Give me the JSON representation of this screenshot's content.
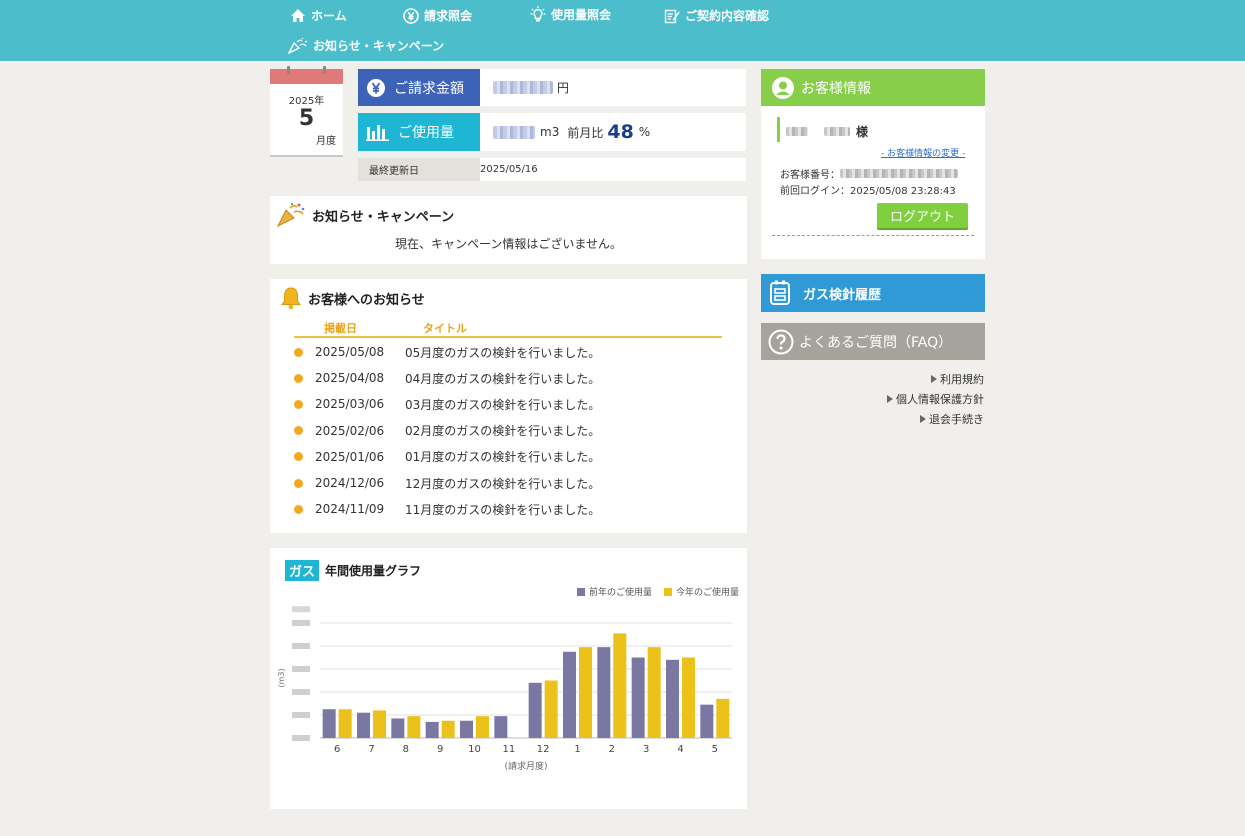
{
  "nav": {
    "home": "ホーム",
    "billing": "請求照会",
    "usage": "使用量照会",
    "contract": "ご契約内容確認",
    "news": "お知らせ・キャンペーン"
  },
  "calendar": {
    "year": "2025年",
    "month": "5",
    "unit": "月度"
  },
  "billing": {
    "amount_label": "ご請求金額",
    "amount_unit": "円",
    "usage_label": "ご使用量",
    "usage_unit": "m3",
    "ratio_label": "前月比",
    "ratio_value": "48",
    "ratio_unit": "%",
    "updated_label": "最終更新日",
    "updated_value": "2025/05/16"
  },
  "campaign": {
    "title": "お知らせ・キャンペーン",
    "message": "現在、キャンペーン情報はございません。"
  },
  "notices": {
    "title": "お客様へのお知らせ",
    "col_date": "掲載日",
    "col_title": "タイトル",
    "items": [
      {
        "date": "2025/05/08",
        "title": "05月度のガスの検針を行いました。"
      },
      {
        "date": "2025/04/08",
        "title": "04月度のガスの検針を行いました。"
      },
      {
        "date": "2025/03/06",
        "title": "03月度のガスの検針を行いました。"
      },
      {
        "date": "2025/02/06",
        "title": "02月度のガスの検針を行いました。"
      },
      {
        "date": "2025/01/06",
        "title": "01月度のガスの検針を行いました。"
      },
      {
        "date": "2024/12/06",
        "title": "12月度のガスの検針を行いました。"
      },
      {
        "date": "2024/11/09",
        "title": "11月度のガスの検針を行いました。"
      }
    ]
  },
  "customer": {
    "title": "お客様情報",
    "honorific": "様",
    "change_link": "- お客様情報の変更 -",
    "number_label": "お客様番号：",
    "login_label": "前回ログイン：2025/05/08 23:28:43",
    "logout": "ログアウト"
  },
  "side": {
    "gas_history": "ガス検針履歴",
    "faq": "よくあるご質問（FAQ）",
    "links": [
      "利用規約",
      "個人情報保護方針",
      "退会手続き"
    ]
  },
  "chart_section": {
    "badge": "ガス",
    "title": "年間使用量グラフ",
    "legend_prev": "前年のご使用量",
    "legend_this": "今年のご使用量",
    "ylabel": "(m3)",
    "xlabel": "(請求月度)"
  },
  "colors": {
    "prev": "#7a77a3",
    "this": "#ecc21a",
    "nav": "#4bbdcb",
    "green": "#87cf4a",
    "blue": "#2f9ad6",
    "gray": "#a5a39b"
  },
  "chart_data": {
    "type": "bar",
    "categories": [
      "6",
      "7",
      "8",
      "9",
      "10",
      "11",
      "12",
      "1",
      "2",
      "3",
      "4",
      "5"
    ],
    "series": [
      {
        "name": "前年のご使用量",
        "values": [
          1.25,
          1.1,
          0.85,
          0.7,
          0.75,
          0.95,
          2.4,
          3.75,
          3.95,
          3.5,
          3.4,
          1.45
        ]
      },
      {
        "name": "今年のご使用量",
        "values": [
          1.25,
          1.2,
          0.95,
          0.75,
          0.95,
          null,
          2.5,
          3.95,
          4.55,
          3.95,
          3.5,
          1.7
        ]
      }
    ],
    "ylim": [
      0,
      5
    ],
    "ylabel": "(m3)",
    "xlabel": "(請求月度)",
    "grid": true,
    "legend": "top-right"
  }
}
